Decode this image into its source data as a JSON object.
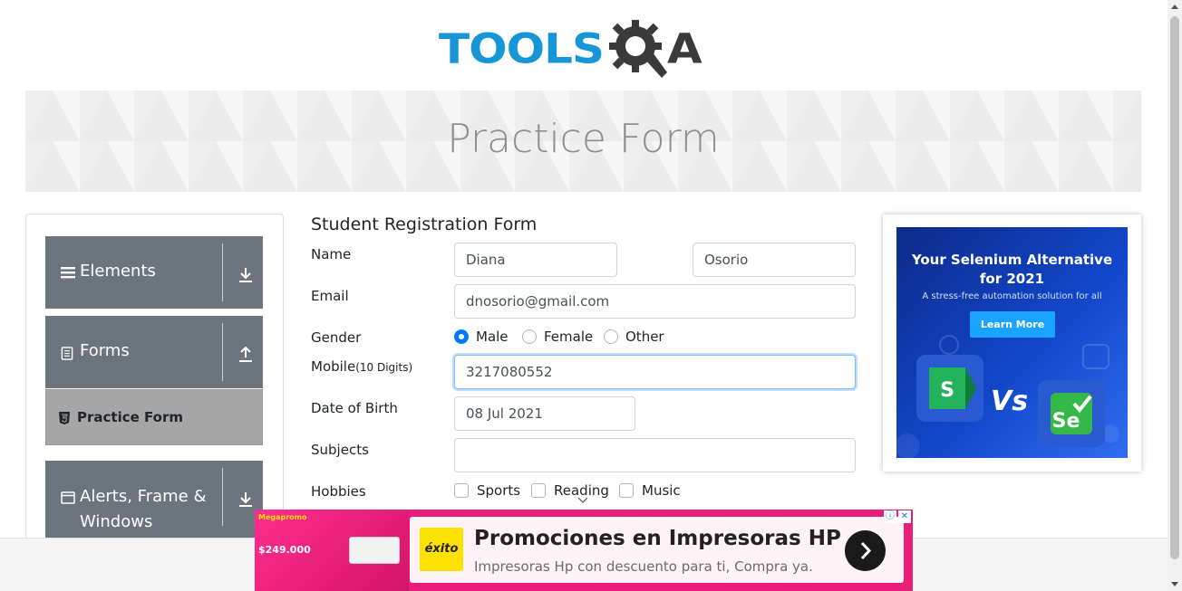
{
  "logo": {
    "part1": "TOOLS",
    "part2": "A"
  },
  "banner": {
    "title": "Practice Form"
  },
  "sidebar": {
    "groups": [
      {
        "label": "Elements",
        "icon": "hamburger-icon",
        "arrow": "download-arrow-icon"
      },
      {
        "label": "Forms",
        "icon": "document-icon",
        "arrow": "upload-arrow-icon"
      },
      {
        "label": "Alerts, Frame &",
        "label2": "Windows",
        "icon": "window-icon",
        "arrow": "download-arrow-icon"
      }
    ],
    "active_item": {
      "label": "Practice Form",
      "icon": "html5-icon"
    }
  },
  "form": {
    "title": "Student Registration Form",
    "name_label": "Name",
    "first_name": "Diana",
    "last_name": "Osorio",
    "email_label": "Email",
    "email": "dnosorio@gmail.com",
    "gender_label": "Gender",
    "genders": [
      "Male",
      "Female",
      "Other"
    ],
    "selected_gender": "Male",
    "mobile_label": "Mobile",
    "mobile_hint": "(10 Digits)",
    "mobile": "3217080552",
    "dob_label": "Date of Birth",
    "dob": "08 Jul 2021",
    "subjects_label": "Subjects",
    "subjects": "",
    "hobbies_label": "Hobbies",
    "hobbies": [
      "Sports",
      "Reading",
      "Music"
    ]
  },
  "side_ad": {
    "title_line1": "Your Selenium Alternative",
    "title_line2": "for 2021",
    "subtitle": "A stress-free automation solution for all",
    "button": "Learn More",
    "vs": "Vs"
  },
  "bottom_ad": {
    "title": "Promociones en Impresoras HP",
    "subtitle": "Impresoras Hp con descuento para ti, Compra ya.",
    "brand": "éxito",
    "tag": "Megapromo",
    "price": "$249.000"
  },
  "colors": {
    "brand_blue": "#1696d6",
    "sidebar_group": "#6c757d",
    "sidebar_active": "#a6a6a6",
    "radio_checked": "#007bff",
    "ad_pink": "#e91e7a"
  }
}
